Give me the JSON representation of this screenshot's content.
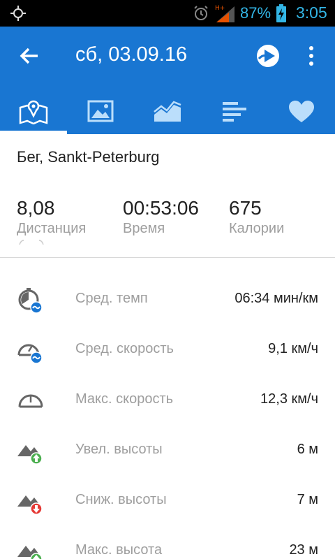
{
  "status_bar": {
    "network": "H+",
    "battery_percent": "87%",
    "time": "3:05"
  },
  "app_bar": {
    "title": "сб, 03.09.16"
  },
  "tabs": [
    {
      "name": "map-icon",
      "active": true
    },
    {
      "name": "photo-icon",
      "active": false
    },
    {
      "name": "chart-icon",
      "active": false
    },
    {
      "name": "splits-icon",
      "active": false
    },
    {
      "name": "heart-icon",
      "active": false
    }
  ],
  "activity": {
    "title": "Бег, Sankt-Peterburg"
  },
  "summary": [
    {
      "value": "8,08",
      "label": "Дистанция"
    },
    {
      "value": "00:53:06",
      "label": "Время"
    },
    {
      "value": "675",
      "label": "Калории"
    }
  ],
  "stats": [
    {
      "icon": "avg-pace-icon",
      "label": "Сред. темп",
      "value": "06:34 мин/км"
    },
    {
      "icon": "avg-speed-icon",
      "label": "Сред. скорость",
      "value": "9,1 км/ч"
    },
    {
      "icon": "max-speed-icon",
      "label": "Макс. скорость",
      "value": "12,3 км/ч"
    },
    {
      "icon": "elevation-gain-icon",
      "label": "Увел. высоты",
      "value": "6 м"
    },
    {
      "icon": "elevation-loss-icon",
      "label": "Сниж. высоты",
      "value": "7 м"
    },
    {
      "icon": "max-elevation-icon",
      "label": "Макс. высота",
      "value": "23 м"
    }
  ],
  "colors": {
    "primary": "#1976d2",
    "status_text": "#33b5e5",
    "secondary_text": "#9e9e9e",
    "up_green": "#4caf50",
    "down_red": "#e53935"
  }
}
